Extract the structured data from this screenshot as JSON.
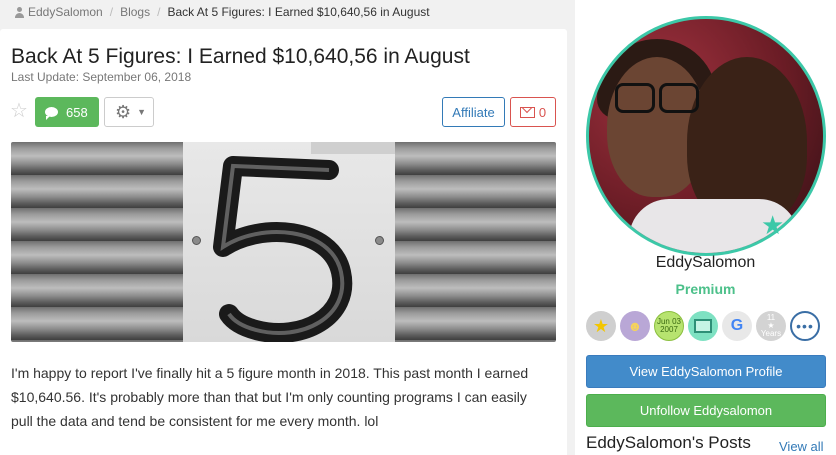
{
  "breadcrumb": {
    "user": "EddySalomon",
    "section": "Blogs",
    "current": "Back At 5 Figures: I Earned $10,640,56 in August"
  },
  "post": {
    "title": "Back At 5 Figures: I Earned $10,640,56 in August",
    "last_update": "Last Update: September 06, 2018",
    "comment_count": "658",
    "affiliate_label": "Affiliate",
    "mail_count": "0",
    "body": "I'm happy to report I've finally hit a 5 figure month in 2018. This past month I earned $10,640.56. It's probably more than that but I'm only counting programs I can easily pull the data and tend be consistent for me every month. lol"
  },
  "hero_image": {
    "digit": "5"
  },
  "sidebar": {
    "username": "EddySalomon",
    "member_level": "Premium",
    "badges": {
      "date": "Jun 03 2007",
      "google": "G",
      "years_top": "11",
      "years_bottom": "Years",
      "more": "•••"
    },
    "view_profile_label": "View EddySalomon Profile",
    "unfollow_label": "Unfollow Eddysalomon",
    "posts_title": "EddySalomon's Posts",
    "view_all_label": "View all"
  },
  "colors": {
    "accent_green": "#5cb85c",
    "accent_blue": "#428bca",
    "premium": "#4cc08a",
    "avatar_ring": "#3cc8a8",
    "danger": "#d9534f"
  },
  "icons": [
    "user-icon",
    "star-icon",
    "comment-icon",
    "gear-icon",
    "chevron-down-icon",
    "envelope-icon",
    "premium-star-icon"
  ]
}
